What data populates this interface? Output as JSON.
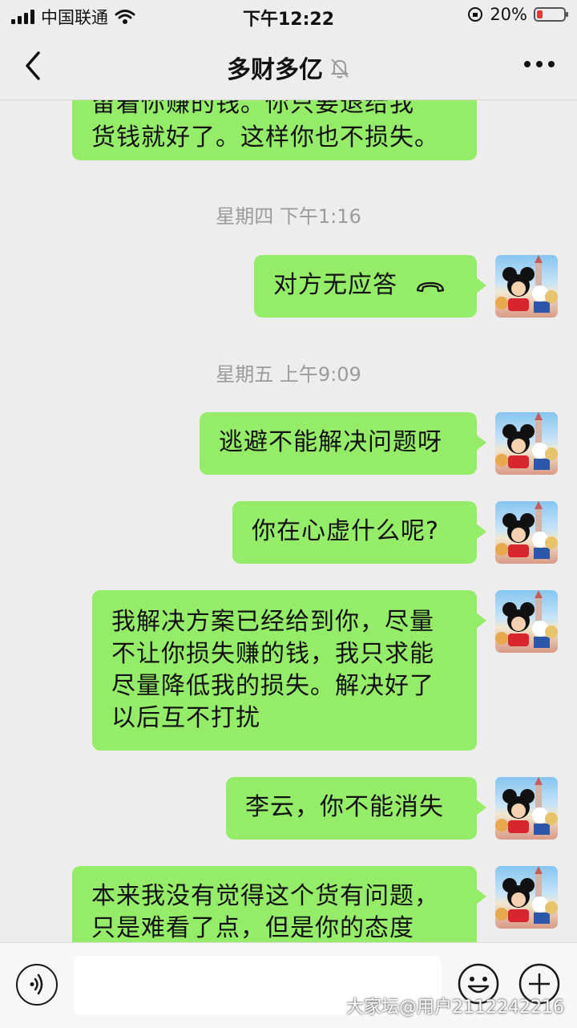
{
  "status_bar": {
    "carrier": "中国联通",
    "time": "下午12:22",
    "battery_percent": "20%",
    "battery_level": 0.2,
    "battery_color": "#e13a35"
  },
  "nav": {
    "title": "多财多亿",
    "icons": [
      "back-chevron-icon",
      "mute-bell-icon",
      "more-dots-icon"
    ]
  },
  "messages": {
    "m0": {
      "lines": [
        "留着你赚的钱。你只要退给我",
        "货钱就好了。这样你也不损失。"
      ]
    },
    "ts1": "星期四 下午1:16",
    "m1": {
      "text": "对方无应答",
      "icon": "phone-hangup-icon"
    },
    "ts2": "星期五 上午9:09",
    "m2": {
      "text": "逃避不能解决问题呀"
    },
    "m3": {
      "text": "你在心虚什么呢?"
    },
    "m4": {
      "lines": [
        "我解决方案已经给到你，尽量",
        "不让你损失赚的钱，我只求能",
        "尽量降低我的损失。解决好了",
        "以后互不打扰"
      ]
    },
    "m5": {
      "text": "李云，你不能消失"
    },
    "m6": {
      "lines": [
        "本来我没有觉得这个货有问题，",
        "只是难看了点，但是你的态度"
      ]
    }
  },
  "input_bar": {
    "value": "",
    "icons": [
      "voice-icon",
      "emoji-icon",
      "plus-icon"
    ]
  },
  "watermark": "大家坛@用户2112242216",
  "colors": {
    "bubble_green": "#95ec69",
    "background": "#ededed",
    "timestamp_gray": "#9b9b9b"
  }
}
